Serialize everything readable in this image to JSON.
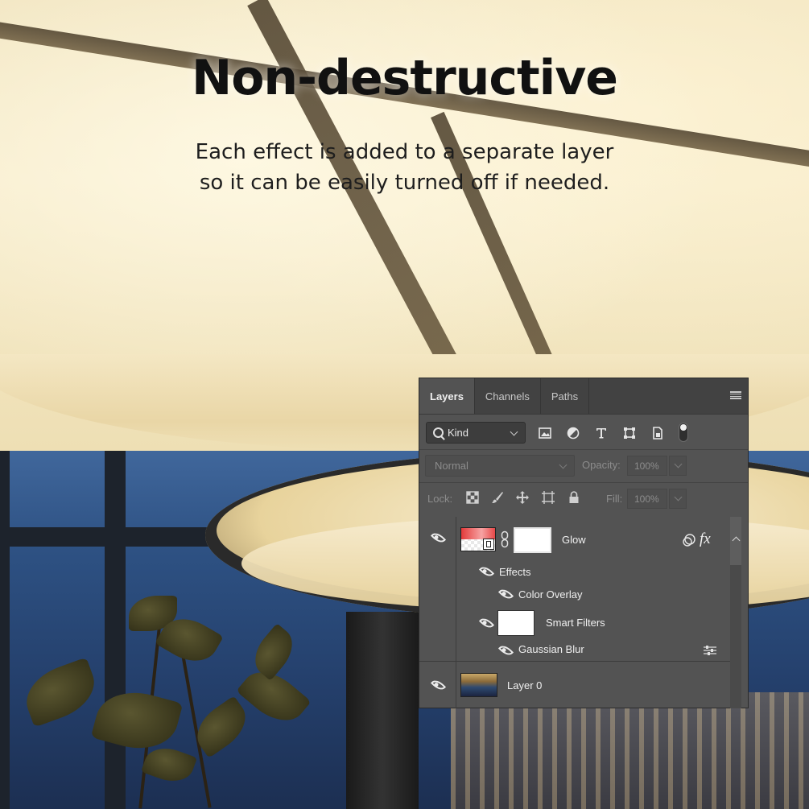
{
  "headline": {
    "title": "Non-destructive",
    "subtitle_line1": "Each effect is added to a separate layer",
    "subtitle_line2": "so it can be easily turned off if needed."
  },
  "layers_panel": {
    "tabs": [
      {
        "label": "Layers",
        "active": true
      },
      {
        "label": "Channels",
        "active": false
      },
      {
        "label": "Paths",
        "active": false
      }
    ],
    "filter": {
      "kind_label": "Kind",
      "icons": [
        "image-filter-icon",
        "adjustment-filter-icon",
        "type-filter-icon",
        "shape-filter-icon",
        "smart-object-filter-icon"
      ]
    },
    "blend_mode": "Normal",
    "opacity_label": "Opacity:",
    "opacity_value": "100%",
    "lock_label": "Lock:",
    "fill_label": "Fill:",
    "fill_value": "100%",
    "layers": [
      {
        "name": "Glow",
        "visible": true,
        "badge": "fx"
      },
      {
        "name": "Effects",
        "visible": true
      },
      {
        "name": "Color Overlay",
        "visible": true
      },
      {
        "name": "Smart Filters",
        "visible": true
      },
      {
        "name": "Gaussian Blur",
        "visible": true
      },
      {
        "name": "Layer 0",
        "visible": true
      }
    ]
  },
  "colors": {
    "panel_bg": "#535353",
    "tab_bar_bg": "#424242",
    "headline": "#111111"
  }
}
